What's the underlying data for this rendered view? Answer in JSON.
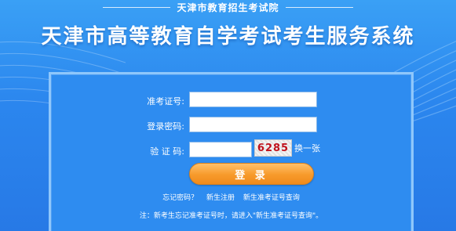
{
  "header": {
    "subtitle": "天津市教育招生考试院",
    "title": "天津市高等教育自学考试考生服务系统"
  },
  "form": {
    "exam_id_label": "准考证号:",
    "password_label": "登录密码:",
    "captcha_label": "验 证 码:",
    "exam_id_value": "",
    "password_value": "",
    "captcha_value": "",
    "captcha_code": "6285",
    "refresh_label": "换一张",
    "login_label": "登 录"
  },
  "links": {
    "forgot_password": "忘记密码？",
    "new_register": "新生注册",
    "exam_id_query": "新生准考证号查询"
  },
  "note": "注：新考生忘记准考证号时，请进入\"新生准考证号查询\"。",
  "colors": {
    "background": "#2b86ee",
    "panel": "#2e8cf0",
    "login_button": "#f79a2b",
    "captcha_text": "#c0121c"
  }
}
